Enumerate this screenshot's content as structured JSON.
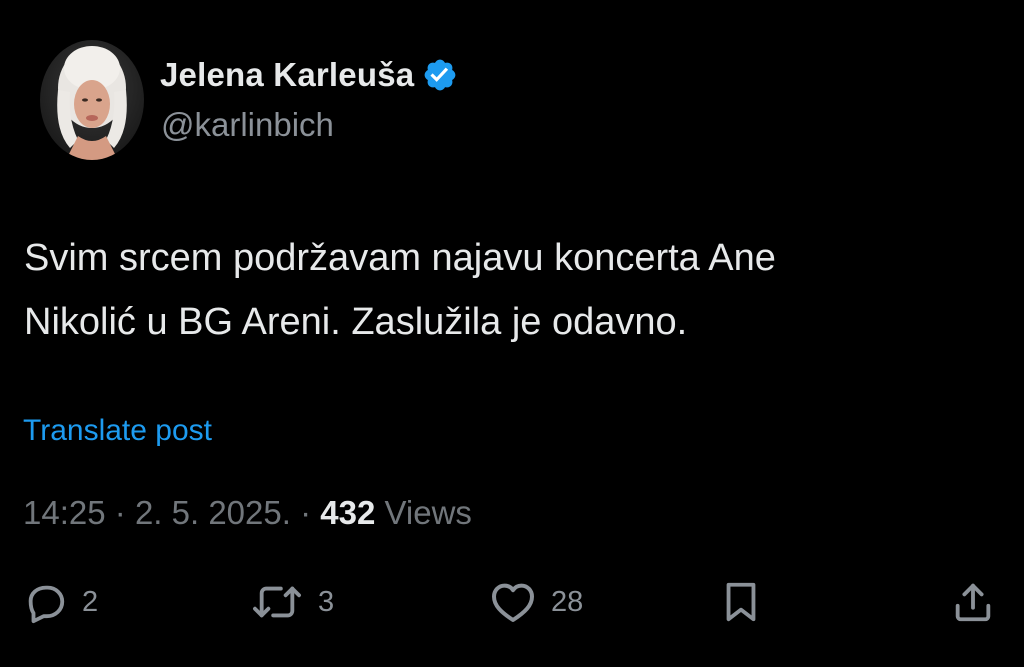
{
  "user": {
    "display_name": "Jelena Karleuša",
    "handle": "@karlinbich",
    "verified": true
  },
  "post": {
    "text_lines": [
      "Svim srcem podržavam najavu koncerta Ane",
      "Nikolić u BG Areni. Zaslužila je odavno."
    ],
    "translate_label": "Translate post",
    "time": "14:25",
    "date": "2. 5. 2025.",
    "separator": "·",
    "views_count": "432",
    "views_label": "Views"
  },
  "actions": {
    "reply_count": "2",
    "repost_count": "3",
    "like_count": "28"
  },
  "colors": {
    "background": "#000000",
    "text_primary": "#e7e9ea",
    "text_secondary": "#71767b",
    "accent": "#1d9bf0"
  },
  "icons": {
    "reply": "reply-icon",
    "repost": "repost-icon",
    "like": "heart-icon",
    "bookmark": "bookmark-icon",
    "share": "share-icon",
    "verified": "verified-badge-icon"
  }
}
